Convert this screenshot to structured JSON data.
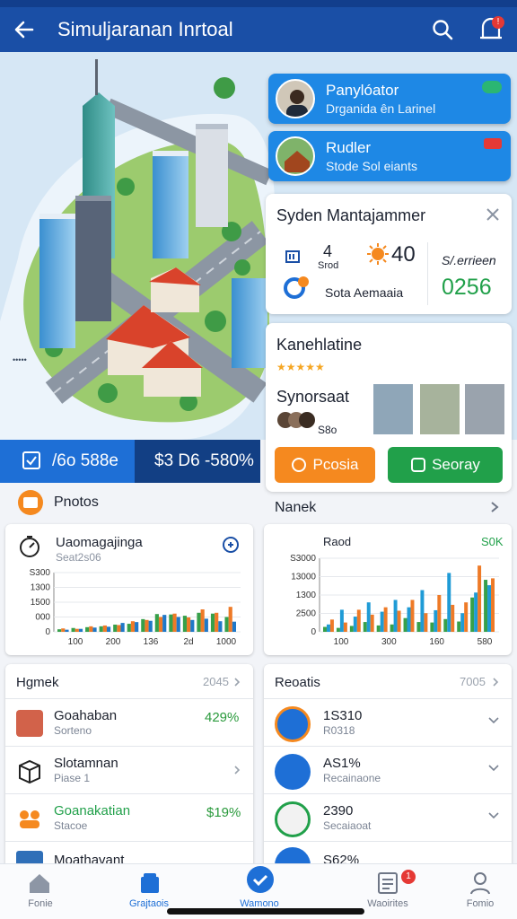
{
  "app_bar": {
    "title": "Simuljaranan Inrtoal"
  },
  "overlay_cards": [
    {
      "title": "Panylóator",
      "subtitle": "Drganida ên Larinel"
    },
    {
      "title": "Rudler",
      "subtitle": "Stode Sol eiants"
    }
  ],
  "system_panel": {
    "title": "Syden Mantajammer",
    "num_left_top": "4",
    "num_left_sub": "Srod",
    "temp": "40",
    "left_label": "Sota Aemaaia",
    "right_label": "S/.errieen",
    "right_value": "0256"
  },
  "kanehlatine": {
    "title": "Kanehlatine",
    "stars": "★★★★★",
    "sub_title": "Synorsaat",
    "sub_sub": "S8o",
    "btn_orange": "Pcosia",
    "btn_green": "Seoray"
  },
  "stat_strip": {
    "left": "/6o 588e",
    "right": "$3 D6 -580%"
  },
  "section_labels": {
    "left": "Pnotos",
    "right": "Nanek"
  },
  "chart_left": {
    "title": "Uaomagajinga",
    "subtitle": "Seat2s06",
    "yticks": [
      "S300",
      "1300",
      "1500",
      "000",
      "0"
    ],
    "xticks": [
      "100",
      "200",
      "136",
      "2d",
      "1000"
    ]
  },
  "chart_right": {
    "title": "Raod",
    "value": "S0K",
    "yticks": [
      "S3000",
      "13000",
      "1300",
      "2500",
      "0"
    ],
    "xticks": [
      "100",
      "300",
      "160",
      "580"
    ]
  },
  "chart_data": [
    {
      "type": "bar",
      "title": "Uaomagajinga",
      "x": [
        "100",
        "200",
        "136",
        "2d",
        "1000"
      ],
      "ylim": [
        0,
        2800
      ],
      "series": [
        {
          "color": "#37a04a",
          "values": [
            120,
            180,
            220,
            260,
            340,
            380,
            600,
            840,
            820,
            760,
            900,
            860,
            700
          ]
        },
        {
          "color": "#ee7a27",
          "values": [
            160,
            140,
            260,
            300,
            320,
            500,
            560,
            700,
            860,
            680,
            1060,
            900,
            1180
          ]
        },
        {
          "color": "#1f78c8",
          "values": [
            100,
            140,
            200,
            240,
            420,
            460,
            520,
            800,
            700,
            560,
            620,
            500,
            480
          ]
        }
      ]
    },
    {
      "type": "bar",
      "title": "Raod",
      "x": [
        "100",
        "300",
        "160",
        "580"
      ],
      "ylim": [
        0,
        3000
      ],
      "series": [
        {
          "color": "#37a04a",
          "values": [
            200,
            160,
            240,
            400,
            260,
            300,
            560,
            400,
            380,
            520,
            420,
            1400,
            2120
          ]
        },
        {
          "color": "#1f9bd6",
          "values": [
            300,
            900,
            620,
            1200,
            820,
            1300,
            1000,
            1700,
            880,
            2400,
            760,
            1600,
            1900
          ]
        },
        {
          "color": "#ee7a27",
          "values": [
            500,
            380,
            900,
            700,
            1000,
            860,
            1300,
            760,
            1500,
            1100,
            1200,
            2700,
            2180
          ]
        }
      ]
    }
  ],
  "list_left": {
    "header": "Hgmek",
    "header_meta": "2045",
    "items": [
      {
        "name": "Goahaban",
        "sub": "Sorteno",
        "value": "429%",
        "value_color": "#2a9a3c"
      },
      {
        "name": "Slotamnan",
        "sub": "Piase 1",
        "value": "",
        "value_color": "#2a9a3c"
      },
      {
        "name": "Goanakatian",
        "sub": "Stacoe",
        "value": "$19%",
        "value_color": "#2a9a3c"
      },
      {
        "name": "Moathavant",
        "sub": "",
        "value": "",
        "value_color": "#2a9a3c"
      }
    ]
  },
  "list_right": {
    "header": "Reoatis",
    "header_meta": "7005",
    "items": [
      {
        "name": "1S310",
        "sub": "R0318"
      },
      {
        "name": "AS1%",
        "sub": "Recainaone"
      },
      {
        "name": "2390",
        "sub": "Secaiaoat"
      },
      {
        "name": "S62%",
        "sub": ""
      }
    ]
  },
  "bottom_nav": [
    {
      "label": "Fonie",
      "icon": "home-icon"
    },
    {
      "label": "Grajtaois",
      "icon": "store-icon"
    },
    {
      "label": "Wamono",
      "icon": "check-icon"
    },
    {
      "label": "Waoirites",
      "icon": "list-icon"
    },
    {
      "label": "Fomio",
      "icon": "profile-icon"
    }
  ],
  "notification_badges": {
    "top": "!",
    "nav": "1"
  },
  "colors": {
    "primary": "#1a4fa6",
    "accent": "#1e88e5",
    "orange": "#f5891f",
    "green": "#21a04a",
    "red": "#e53935"
  }
}
